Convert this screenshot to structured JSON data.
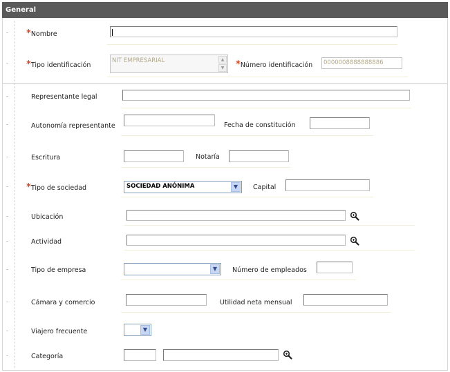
{
  "section": {
    "title": "General"
  },
  "required_mark": "*",
  "fields": {
    "nombre": {
      "label": "Nombre",
      "value": ""
    },
    "tipo_identificacion": {
      "label": "Tipo identificación",
      "value": "NIT EMPRESARIAL"
    },
    "numero_identificacion": {
      "label": "Número identificación",
      "value": "0000008888888886"
    },
    "representante_legal": {
      "label": "Representante legal",
      "value": ""
    },
    "autonomia_representante": {
      "label": "Autonomía representante",
      "value": ""
    },
    "fecha_constitucion": {
      "label": "Fecha de constitución",
      "value": ""
    },
    "escritura": {
      "label": "Escritura",
      "value": ""
    },
    "notaria": {
      "label": "Notaría",
      "value": ""
    },
    "tipo_sociedad": {
      "label": "Tipo de sociedad",
      "value": "SOCIEDAD ANÓNIMA"
    },
    "capital": {
      "label": "Capital",
      "value": ""
    },
    "ubicacion": {
      "label": "Ubicación",
      "value": ""
    },
    "actividad": {
      "label": "Actividad",
      "value": ""
    },
    "tipo_empresa": {
      "label": "Tipo de empresa",
      "value": ""
    },
    "numero_empleados": {
      "label": "Número de empleados",
      "value": ""
    },
    "camara_comercio": {
      "label": "Cámara y comercio",
      "value": ""
    },
    "utilidad_neta": {
      "label": "Utilidad neta mensual",
      "value": ""
    },
    "viajero_frecuente": {
      "label": "Viajero frecuente",
      "value": ""
    },
    "categoria": {
      "label": "Categoría",
      "value": "",
      "value2": ""
    }
  },
  "icons": {
    "lookup": "magnifier-icon",
    "dropdown": "chevron-down-icon"
  },
  "colors": {
    "header_bg": "#5a5a5a",
    "required": "#d0492a",
    "select_border": "#7f9db9",
    "select_button": "#c7d7f3"
  }
}
